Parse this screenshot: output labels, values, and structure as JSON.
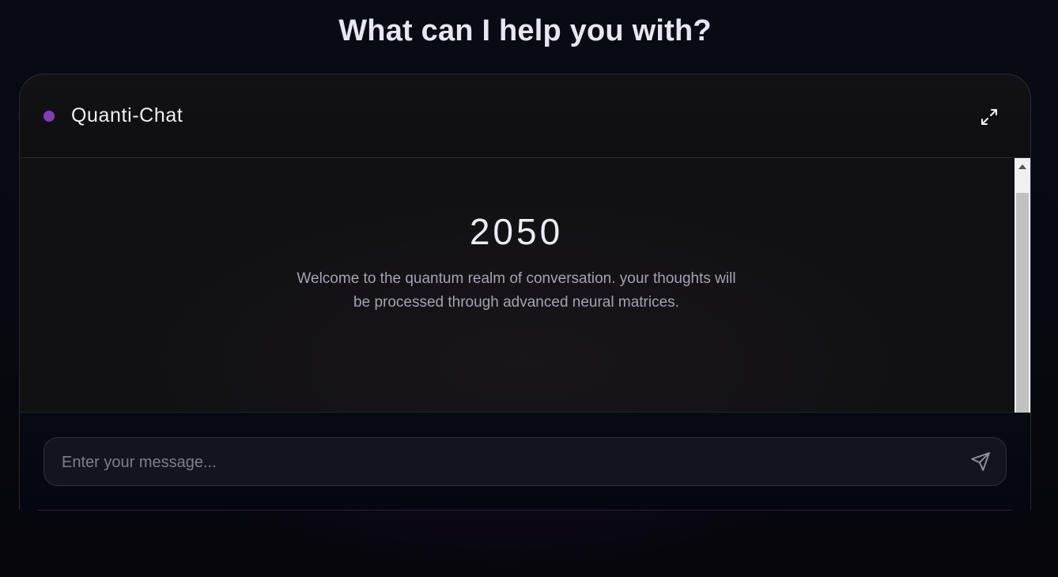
{
  "page": {
    "heading": "What can I help you with?"
  },
  "chat": {
    "title": "Quanti-Chat",
    "status_color": "#7e3fb5",
    "expand_icon": "expand-icon"
  },
  "messages": {
    "big_number": "2050",
    "welcome_text": "Welcome to the quantum realm of conversation. your thoughts will be processed through advanced neural matrices."
  },
  "composer": {
    "placeholder": "Enter your message...",
    "value": "",
    "send_icon": "send-icon"
  },
  "colors": {
    "accent": "#7e3fb5",
    "background": "#05050b",
    "panel": "#111114"
  }
}
